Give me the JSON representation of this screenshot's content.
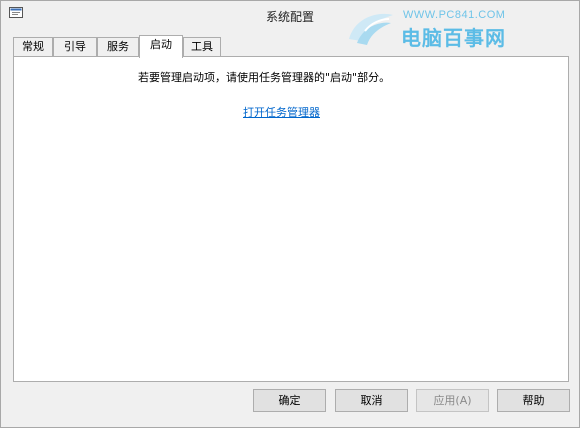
{
  "window": {
    "title": "系统配置"
  },
  "watermark": {
    "url": "WWW.PC841.COM",
    "name": "电脑百事网"
  },
  "tabs": [
    {
      "label": "常规",
      "active": false
    },
    {
      "label": "引导",
      "active": false
    },
    {
      "label": "服务",
      "active": false
    },
    {
      "label": "启动",
      "active": true
    },
    {
      "label": "工具",
      "active": false
    }
  ],
  "startup_panel": {
    "info_text": "若要管理启动项，请使用任务管理器的\"启动\"部分。",
    "link_text": "打开任务管理器"
  },
  "buttons": {
    "ok": "确定",
    "cancel": "取消",
    "apply": "应用(A)",
    "help": "帮助"
  },
  "colors": {
    "link": "#0066cc",
    "watermark": "#5cbce6"
  }
}
